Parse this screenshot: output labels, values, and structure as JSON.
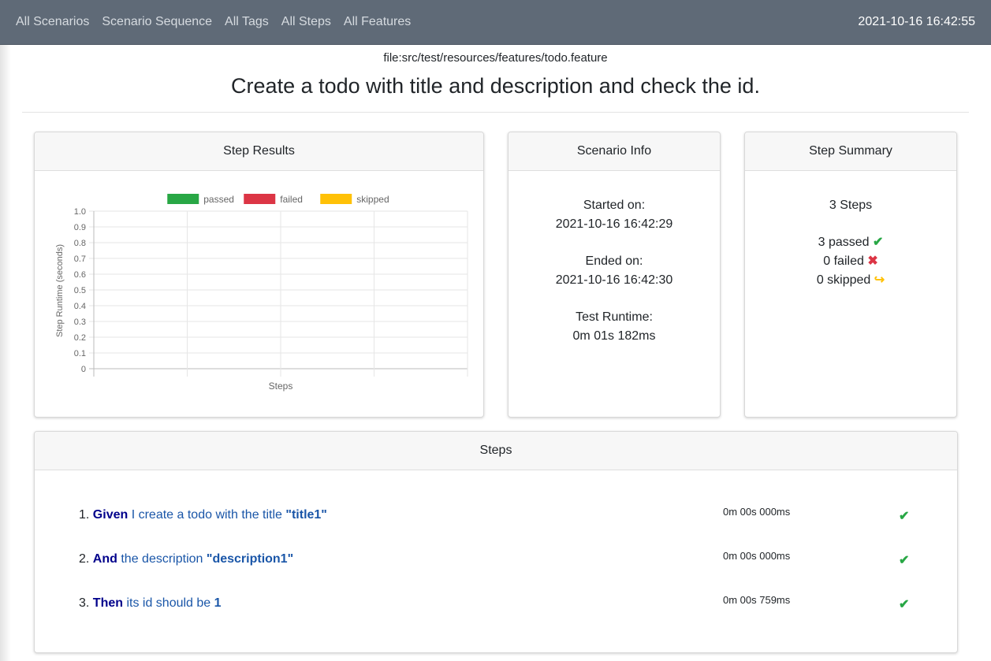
{
  "nav": {
    "links": [
      "All Scenarios",
      "Scenario Sequence",
      "All Tags",
      "All Steps",
      "All Features"
    ],
    "datetime": "2021-10-16 16:42:55"
  },
  "feature_file": "file:src/test/resources/features/todo.feature",
  "scenario_title": "Create a todo with title and description and check the id.",
  "step_results": {
    "header": "Step Results",
    "chart_data": {
      "type": "bar",
      "categories": [],
      "series": [
        {
          "name": "passed",
          "values": [],
          "color": "#28a745"
        },
        {
          "name": "failed",
          "values": [],
          "color": "#dc3545"
        },
        {
          "name": "skipped",
          "values": [],
          "color": "#ffc107"
        }
      ],
      "xlabel": "Steps",
      "ylabel": "Step Runtime (seconds)",
      "ylim": [
        0,
        1.0
      ],
      "yticks": [
        "1.0",
        "0.9",
        "0.8",
        "0.7",
        "0.6",
        "0.5",
        "0.4",
        "0.3",
        "0.2",
        "0.1",
        "0"
      ],
      "grid": true,
      "legend_position": "top"
    }
  },
  "scenario_info": {
    "header": "Scenario Info",
    "started_label": "Started on:",
    "started_value": "2021-10-16 16:42:29",
    "ended_label": "Ended on:",
    "ended_value": "2021-10-16 16:42:30",
    "runtime_label": "Test Runtime:",
    "runtime_value": "0m 01s 182ms"
  },
  "step_summary": {
    "header": "Step Summary",
    "total": "3 Steps",
    "passed": "3 passed",
    "failed": "0 failed",
    "skipped": "0 skipped"
  },
  "steps": {
    "header": "Steps",
    "items": [
      {
        "num": "1.",
        "keyword": "Given",
        "text": " I create a todo with the title ",
        "arg": "\"title1\"",
        "time": "0m 00s 000ms",
        "status": "passed"
      },
      {
        "num": "2.",
        "keyword": "And",
        "text": " the description ",
        "arg": "\"description1\"",
        "time": "0m 00s 000ms",
        "status": "passed"
      },
      {
        "num": "3.",
        "keyword": "Then",
        "text": " its id should be ",
        "arg": "1",
        "time": "0m 00s 759ms",
        "status": "passed"
      }
    ]
  },
  "colors": {
    "navbar": "#5f6a77",
    "passed": "#28a745",
    "failed": "#dc3545",
    "skipped": "#ffc107",
    "keyword": "#00008b",
    "step_text": "#1a56a8"
  }
}
